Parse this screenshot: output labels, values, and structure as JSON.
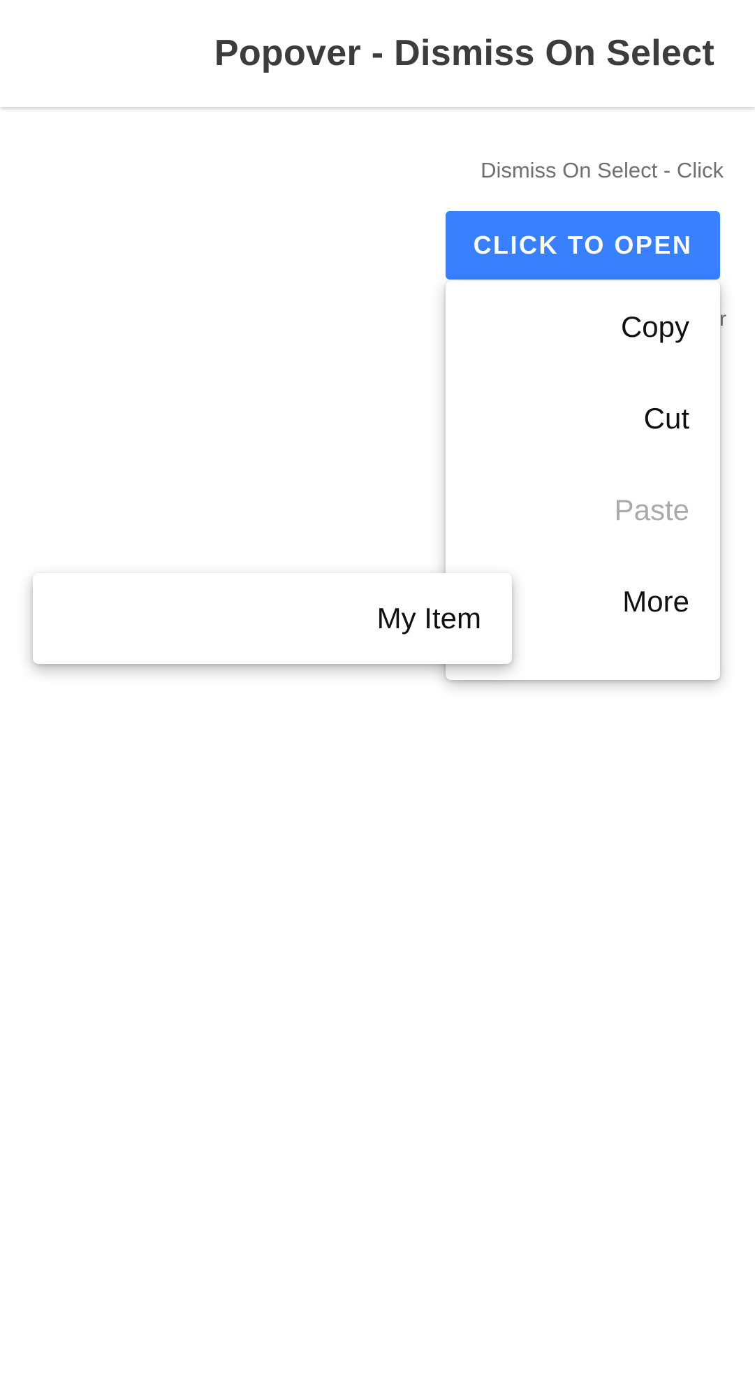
{
  "header": {
    "title": "Popover - Dismiss On Select"
  },
  "section": {
    "label": "Dismiss On Select - Click"
  },
  "trigger": {
    "label": "CLICK TO OPEN",
    "color": "#3880ff"
  },
  "background": {
    "partial_char": "r"
  },
  "popover": {
    "items": [
      {
        "label": "Copy",
        "disabled": false
      },
      {
        "label": "Cut",
        "disabled": false
      },
      {
        "label": "Paste",
        "disabled": true
      },
      {
        "label": "More",
        "disabled": false
      }
    ]
  },
  "nested_popover": {
    "item_label": "My Item"
  }
}
